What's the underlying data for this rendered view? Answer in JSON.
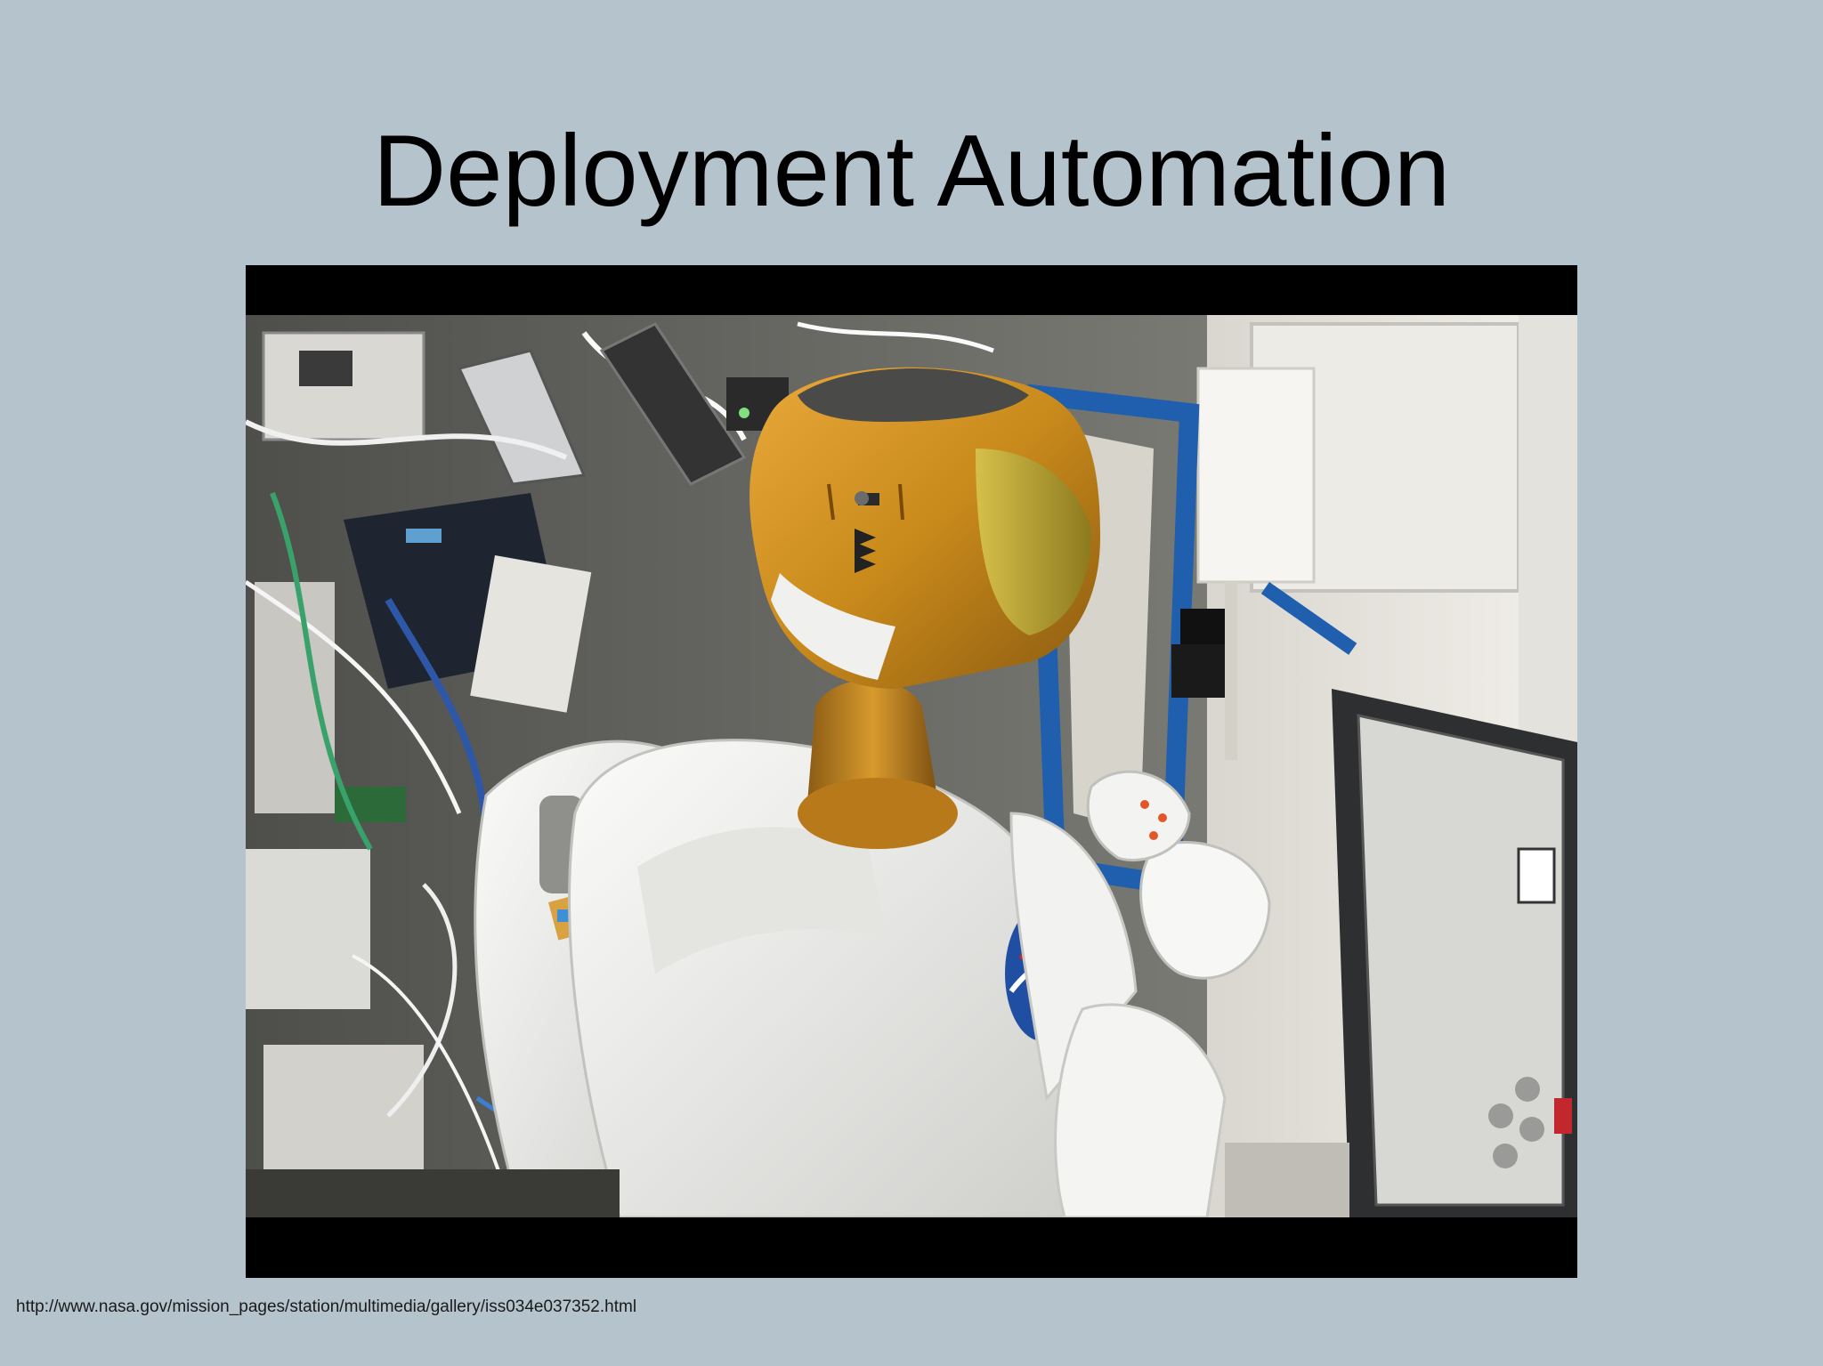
{
  "slide": {
    "title": "Deployment Automation",
    "image_alt": "Robonaut 2 humanoid robot with gold helmet inside the International Space Station",
    "source_url": "http://www.nasa.gov/mission_pages/station/multimedia/gallery/iss034e037352.html"
  },
  "colors": {
    "background": "#b5c3cd",
    "letterbox": "#000000",
    "title_text": "#000000",
    "helmet_gold": "#c98a1c",
    "suit_white": "#eeeeec",
    "hatch_blue": "#1f5fae"
  }
}
